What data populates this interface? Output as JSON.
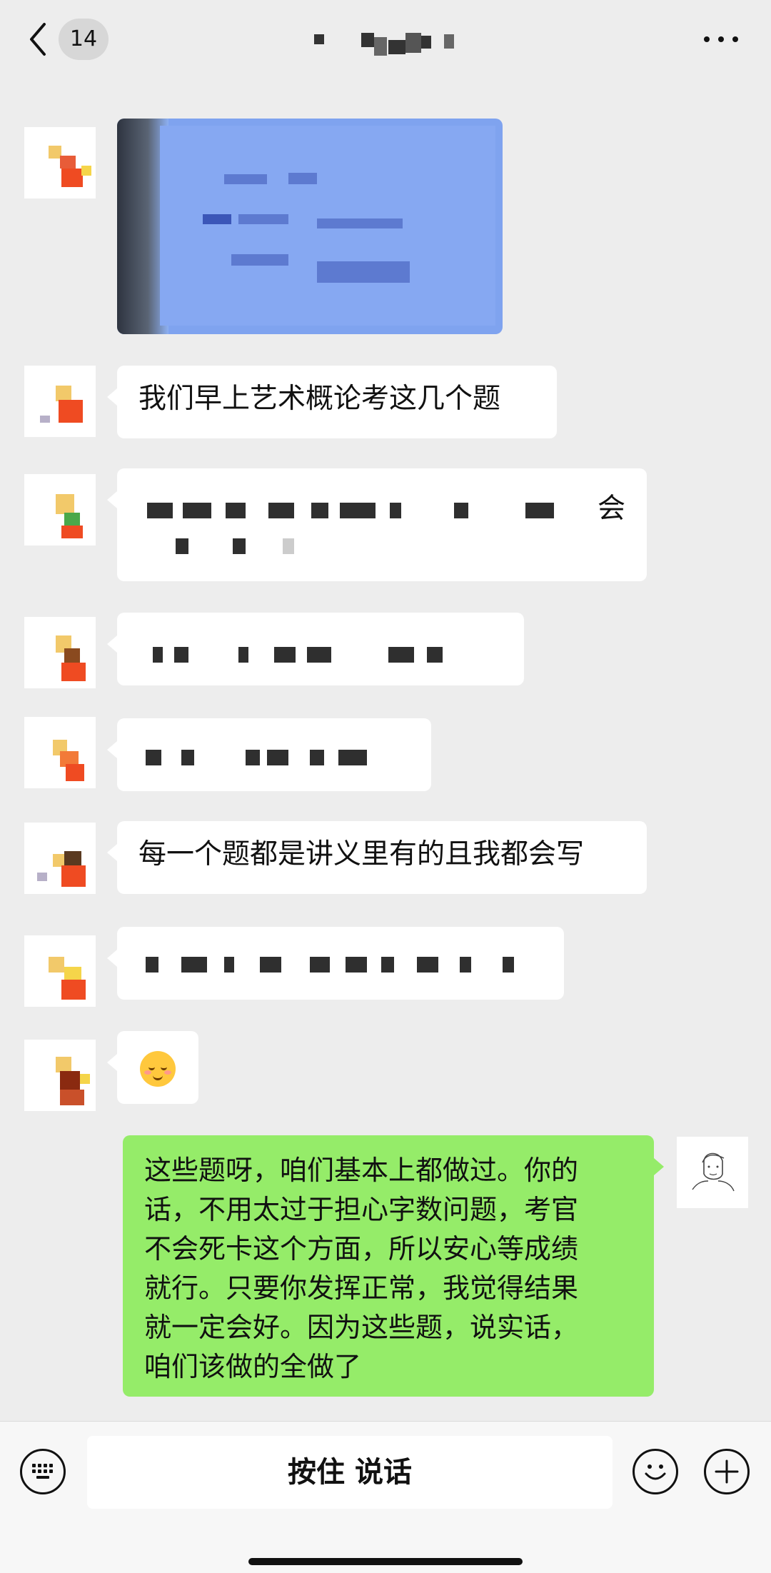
{
  "header": {
    "unread_count": "14"
  },
  "messages": [
    {
      "side": "left",
      "type": "image"
    },
    {
      "side": "left",
      "type": "text",
      "text": "我们早上艺术概论考这几个题"
    },
    {
      "side": "left",
      "type": "text",
      "text_visible_fragment": "会",
      "obscured": true
    },
    {
      "side": "left",
      "type": "text",
      "obscured": true
    },
    {
      "side": "left",
      "type": "text",
      "obscured": true
    },
    {
      "side": "left",
      "type": "text",
      "text": "每一个题都是讲义里有的且我都会写"
    },
    {
      "side": "left",
      "type": "text",
      "obscured": true
    },
    {
      "side": "left",
      "type": "emoji",
      "icon": "smiling-face-emoji"
    }
  ],
  "reply": {
    "side": "right",
    "lines": [
      "这些题呀，咱们基本上都做过。你的",
      "话，不用太过于担心字数问题，考官",
      "不会死卡这个方面，所以安心等成绩",
      "就行。只要你发挥正常，我觉得结果",
      "就一定会好。因为这些题，说实话，",
      "咱们该做的全做了"
    ]
  },
  "inputbar": {
    "hold_to_talk_label": "按住 说话"
  },
  "colors": {
    "background": "#ededed",
    "incoming_bubble": "#ffffff",
    "outgoing_bubble": "#95ec69"
  }
}
